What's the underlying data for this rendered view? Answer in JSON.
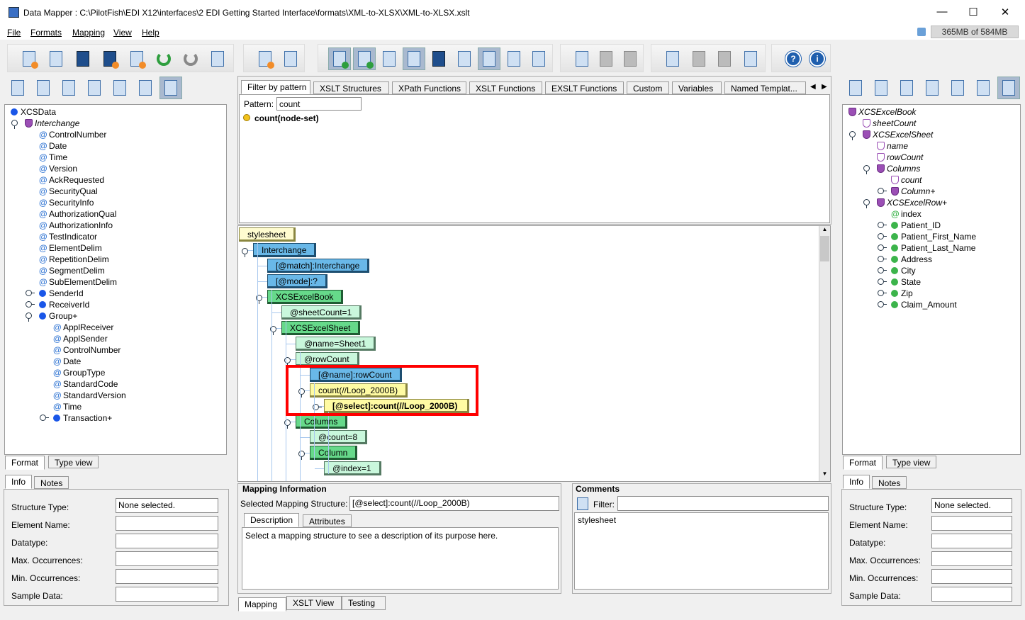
{
  "window": {
    "title": "Data Mapper : C:\\PilotFish\\EDI X12\\interfaces\\2 EDI Getting Started Interface\\formats\\XML-to-XLSX\\XML-to-XLSX.xslt",
    "minimize": "—",
    "maximize": "☐",
    "close": "✕"
  },
  "menu": [
    {
      "label": "File"
    },
    {
      "label": "Formats"
    },
    {
      "label": "Mapping"
    },
    {
      "label": "View"
    },
    {
      "label": "Help"
    }
  ],
  "memory": "365MB of 584MB",
  "toolbar_icons": [
    "new-format",
    "open",
    "save",
    "save-as",
    "new-xls",
    "undo",
    "redo",
    "exit",
    "new-mapping",
    "mapping-settings",
    "info-view",
    "color-view",
    "checklist",
    "xslt-source",
    "save-timer",
    "document",
    "at-document",
    "table-grid",
    "database",
    "cut",
    "copy",
    "paste",
    "move-up",
    "align",
    "align-bottom",
    "stack",
    "help",
    "about"
  ],
  "left": {
    "tree": [
      {
        "label": "XCSData",
        "icon": "blue-dot",
        "depth": 0
      },
      {
        "label": "Interchange",
        "icon": "shield",
        "depth": 1,
        "italic": true,
        "exp": "v"
      },
      {
        "label": "ControlNumber",
        "icon": "at",
        "depth": 2
      },
      {
        "label": "Date",
        "icon": "at",
        "depth": 2
      },
      {
        "label": "Time",
        "icon": "at",
        "depth": 2
      },
      {
        "label": "Version",
        "icon": "at",
        "depth": 2
      },
      {
        "label": "AckRequested",
        "icon": "at",
        "depth": 2
      },
      {
        "label": "SecurityQual",
        "icon": "at",
        "depth": 2
      },
      {
        "label": "SecurityInfo",
        "icon": "at",
        "depth": 2
      },
      {
        "label": "AuthorizationQual",
        "icon": "at",
        "depth": 2
      },
      {
        "label": "AuthorizationInfo",
        "icon": "at",
        "depth": 2
      },
      {
        "label": "TestIndicator",
        "icon": "at",
        "depth": 2
      },
      {
        "label": "ElementDelim",
        "icon": "at",
        "depth": 2
      },
      {
        "label": "RepetitionDelim",
        "icon": "at",
        "depth": 2
      },
      {
        "label": "SegmentDelim",
        "icon": "at",
        "depth": 2
      },
      {
        "label": "SubElementDelim",
        "icon": "at",
        "depth": 2
      },
      {
        "label": "SenderId",
        "icon": "blue-dot",
        "depth": 2,
        "exp": "h"
      },
      {
        "label": "ReceiverId",
        "icon": "blue-dot",
        "depth": 2,
        "exp": "h"
      },
      {
        "label": "Group+",
        "icon": "blue-dot",
        "depth": 2,
        "exp": "v"
      },
      {
        "label": "ApplReceiver",
        "icon": "at",
        "depth": 3
      },
      {
        "label": "ApplSender",
        "icon": "at",
        "depth": 3
      },
      {
        "label": "ControlNumber",
        "icon": "at",
        "depth": 3
      },
      {
        "label": "Date",
        "icon": "at",
        "depth": 3
      },
      {
        "label": "GroupType",
        "icon": "at",
        "depth": 3
      },
      {
        "label": "StandardCode",
        "icon": "at",
        "depth": 3
      },
      {
        "label": "StandardVersion",
        "icon": "at",
        "depth": 3
      },
      {
        "label": "Time",
        "icon": "at",
        "depth": 3
      },
      {
        "label": "Transaction+",
        "icon": "blue-dot",
        "depth": 3,
        "exp": "h"
      }
    ],
    "view_tabs": [
      "Format",
      "Type view"
    ],
    "info_tabs": [
      "Info",
      "Notes"
    ],
    "info": [
      {
        "label": "Structure Type:",
        "value": "None selected."
      },
      {
        "label": "Element Name:",
        "value": ""
      },
      {
        "label": "Datatype:",
        "value": ""
      },
      {
        "label": "Max. Occurrences:",
        "value": ""
      },
      {
        "label": "Min. Occurrences:",
        "value": ""
      },
      {
        "label": "Sample Data:",
        "value": ""
      }
    ]
  },
  "right": {
    "tree": [
      {
        "label": "XCSExcelBook",
        "icon": "shield",
        "depth": 0,
        "italic": true
      },
      {
        "label": "sheetCount",
        "icon": "shield-v",
        "depth": 1,
        "italic": true
      },
      {
        "label": "XCSExcelSheet",
        "icon": "shield",
        "depth": 1,
        "italic": true,
        "exp": "v"
      },
      {
        "label": "name",
        "icon": "shield-v",
        "depth": 2,
        "italic": true
      },
      {
        "label": "rowCount",
        "icon": "shield-v",
        "depth": 2,
        "italic": true
      },
      {
        "label": "Columns",
        "icon": "shield",
        "depth": 2,
        "italic": true,
        "exp": "v"
      },
      {
        "label": "count",
        "icon": "shield-v",
        "depth": 3,
        "italic": true
      },
      {
        "label": "Column+",
        "icon": "shield",
        "depth": 3,
        "italic": true,
        "exp": "h"
      },
      {
        "label": "XCSExcelRow+",
        "icon": "shield",
        "depth": 2,
        "italic": true,
        "exp": "v"
      },
      {
        "label": "index",
        "icon": "at-green",
        "depth": 3
      },
      {
        "label": "Patient_ID",
        "icon": "green-dot",
        "depth": 3,
        "exp": "h"
      },
      {
        "label": "Patient_First_Name",
        "icon": "green-dot",
        "depth": 3,
        "exp": "h"
      },
      {
        "label": "Patient_Last_Name",
        "icon": "green-dot",
        "depth": 3,
        "exp": "h"
      },
      {
        "label": "Address",
        "icon": "green-dot",
        "depth": 3,
        "exp": "h"
      },
      {
        "label": "City",
        "icon": "green-dot",
        "depth": 3,
        "exp": "h"
      },
      {
        "label": "State",
        "icon": "green-dot",
        "depth": 3,
        "exp": "h"
      },
      {
        "label": "Zip",
        "icon": "green-dot",
        "depth": 3,
        "exp": "h"
      },
      {
        "label": "Claim_Amount",
        "icon": "green-dot",
        "depth": 3,
        "exp": "h"
      }
    ],
    "view_tabs": [
      "Format",
      "Type view"
    ],
    "info_tabs": [
      "Info",
      "Notes"
    ],
    "info": [
      {
        "label": "Structure Type:",
        "value": "None selected."
      },
      {
        "label": "Element Name:",
        "value": ""
      },
      {
        "label": "Datatype:",
        "value": ""
      },
      {
        "label": "Max. Occurrences:",
        "value": ""
      },
      {
        "label": "Min. Occurrences:",
        "value": ""
      },
      {
        "label": "Sample Data:",
        "value": ""
      }
    ]
  },
  "center": {
    "function_tabs": [
      "Filter by pattern",
      "XSLT Structures",
      "XPath Functions",
      "XSLT Functions",
      "EXSLT Functions",
      "Custom",
      "Variables",
      "Named Templat..."
    ],
    "pattern_label": "Pattern:",
    "pattern_value": "count",
    "functions": [
      "count(node-set)"
    ],
    "xslt_tree": [
      {
        "label": "stylesheet",
        "color": "sheet",
        "depth": 0
      },
      {
        "label": "Interchange",
        "color": "blue",
        "depth": 1,
        "exp": "v"
      },
      {
        "label": "[@match]:Interchange",
        "color": "blue",
        "depth": 2
      },
      {
        "label": "[@mode]:?",
        "color": "blue",
        "depth": 2
      },
      {
        "label": "XCSExcelBook",
        "color": "green",
        "depth": 2,
        "exp": "v"
      },
      {
        "label": "@sheetCount=1",
        "color": "lgreen",
        "depth": 3
      },
      {
        "label": "XCSExcelSheet",
        "color": "green",
        "depth": 3,
        "exp": "v"
      },
      {
        "label": "@name=Sheet1",
        "color": "lgreen",
        "depth": 4
      },
      {
        "label": "@rowCount",
        "color": "lgreen",
        "depth": 4,
        "exp": "v"
      },
      {
        "label": "[@name]:rowCount",
        "color": "blue",
        "depth": 5
      },
      {
        "label": "count(//Loop_2000B)",
        "color": "yellow",
        "depth": 5,
        "exp": "v"
      },
      {
        "label": "[@select]:count(//Loop_2000B)",
        "color": "yellow",
        "depth": 6,
        "exp": "h",
        "bold": true
      },
      {
        "label": "Columns",
        "color": "green",
        "depth": 4,
        "exp": "v"
      },
      {
        "label": "@count=8",
        "color": "lgreen",
        "depth": 5
      },
      {
        "label": "Column",
        "color": "green",
        "depth": 5,
        "exp": "v"
      },
      {
        "label": "@index=1",
        "color": "lgreen",
        "depth": 6
      }
    ],
    "highlight_color": "#ff0000",
    "mapping_info": {
      "title": "Mapping Information",
      "selected_label": "Selected Mapping Structure:",
      "selected_value": "[@select]:count(//Loop_2000B)",
      "tabs": [
        "Description",
        "Attributes"
      ],
      "description": "Select a mapping structure to see a description of its purpose here."
    },
    "comments": {
      "title": "Comments",
      "filter_label": "Filter:",
      "filter_value": "",
      "items": [
        "stylesheet"
      ]
    },
    "bottom_tabs": [
      "Mapping",
      "XSLT View",
      "Testing"
    ]
  }
}
